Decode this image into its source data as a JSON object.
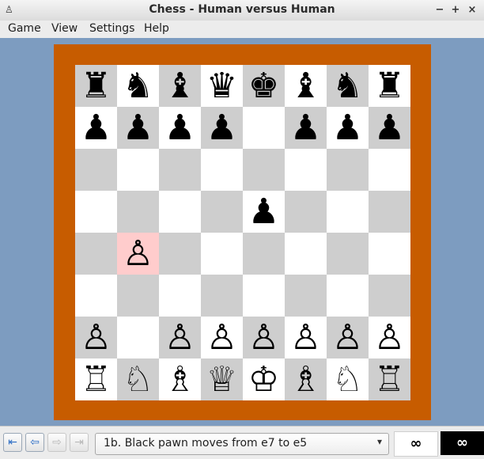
{
  "window": {
    "title": "Chess - Human versus Human",
    "app_icon": "chess-app-icon",
    "minimize_label": "−",
    "maximize_label": "+",
    "close_label": "×"
  },
  "menu": {
    "items": [
      {
        "label": "Game"
      },
      {
        "label": "View"
      },
      {
        "label": "Settings"
      },
      {
        "label": "Help"
      }
    ]
  },
  "board": {
    "light_color": "#ffffff",
    "dark_color": "#cecece",
    "highlight_color": "#ffcccc",
    "frame_color": "#c75c00",
    "background_color": "#7d9cc0",
    "highlight_square": "b4",
    "pieces": [
      {
        "square": "a8",
        "glyph": "♜"
      },
      {
        "square": "b8",
        "glyph": "♞"
      },
      {
        "square": "c8",
        "glyph": "♝"
      },
      {
        "square": "d8",
        "glyph": "♛"
      },
      {
        "square": "e8",
        "glyph": "♚"
      },
      {
        "square": "f8",
        "glyph": "♝"
      },
      {
        "square": "g8",
        "glyph": "♞"
      },
      {
        "square": "h8",
        "glyph": "♜"
      },
      {
        "square": "a7",
        "glyph": "♟"
      },
      {
        "square": "b7",
        "glyph": "♟"
      },
      {
        "square": "c7",
        "glyph": "♟"
      },
      {
        "square": "d7",
        "glyph": "♟"
      },
      {
        "square": "f7",
        "glyph": "♟"
      },
      {
        "square": "g7",
        "glyph": "♟"
      },
      {
        "square": "h7",
        "glyph": "♟"
      },
      {
        "square": "e5",
        "glyph": "♟"
      },
      {
        "square": "b4",
        "glyph": "♙"
      },
      {
        "square": "a2",
        "glyph": "♙"
      },
      {
        "square": "c2",
        "glyph": "♙"
      },
      {
        "square": "d2",
        "glyph": "♙"
      },
      {
        "square": "e2",
        "glyph": "♙"
      },
      {
        "square": "f2",
        "glyph": "♙"
      },
      {
        "square": "g2",
        "glyph": "♙"
      },
      {
        "square": "h2",
        "glyph": "♙"
      },
      {
        "square": "a1",
        "glyph": "♖"
      },
      {
        "square": "b1",
        "glyph": "♘"
      },
      {
        "square": "c1",
        "glyph": "♗"
      },
      {
        "square": "d1",
        "glyph": "♕"
      },
      {
        "square": "e1",
        "glyph": "♔"
      },
      {
        "square": "f1",
        "glyph": "♗"
      },
      {
        "square": "g1",
        "glyph": "♘"
      },
      {
        "square": "h1",
        "glyph": "♖"
      }
    ]
  },
  "history": {
    "buttons": [
      {
        "icon": "first-move-icon",
        "glyph": "⇤",
        "enabled": true
      },
      {
        "icon": "previous-move-icon",
        "glyph": "⇦",
        "enabled": true
      },
      {
        "icon": "next-move-icon",
        "glyph": "⇨",
        "enabled": false
      },
      {
        "icon": "last-move-icon",
        "glyph": "⇥",
        "enabled": false
      }
    ],
    "current_move": "1b. Black pawn moves from e7 to e5",
    "dropdown_icon": "chevron-down-icon"
  },
  "clocks": {
    "white": "∞",
    "black": "∞"
  }
}
